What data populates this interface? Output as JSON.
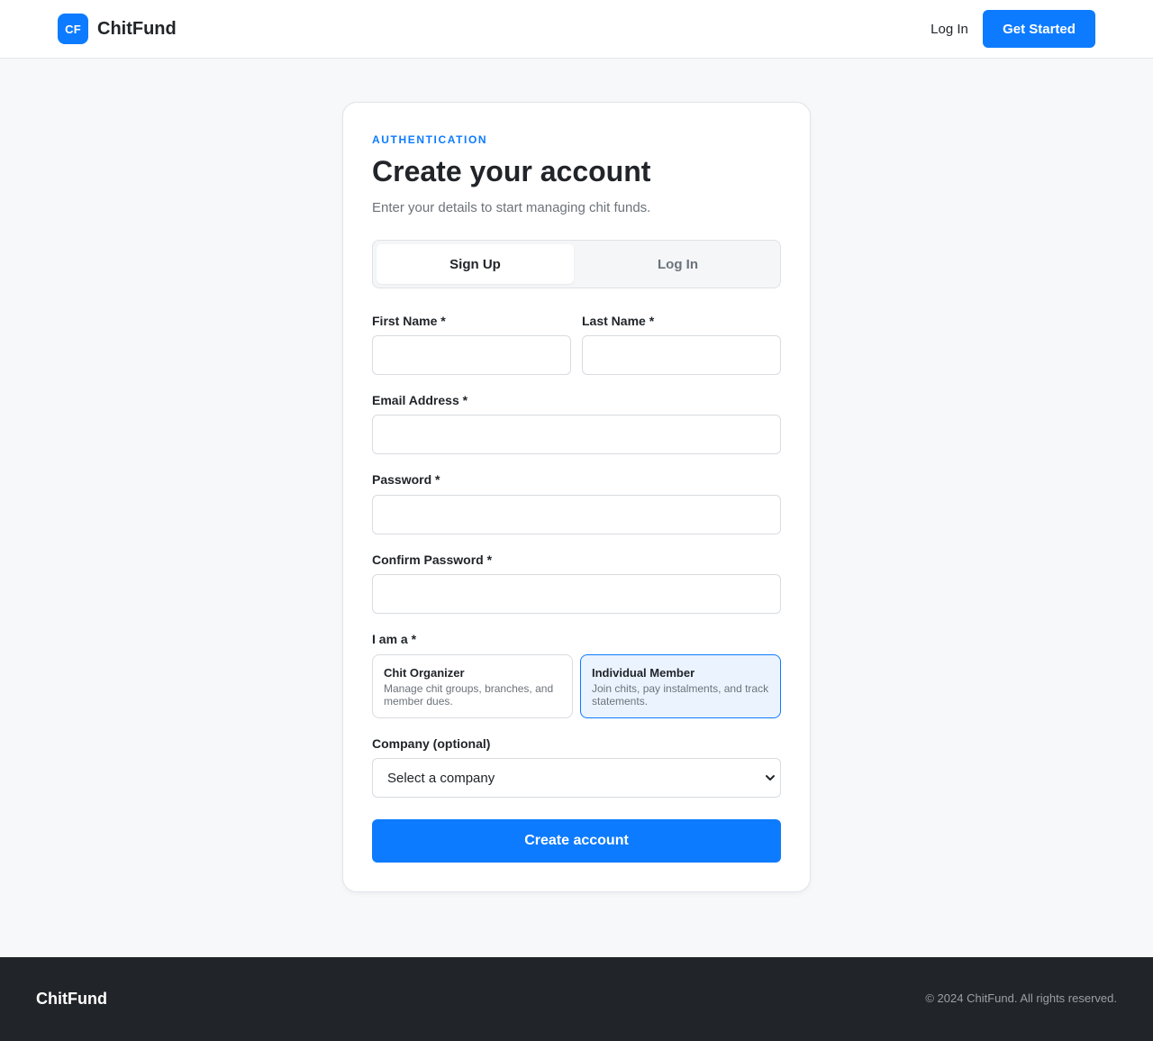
{
  "header": {
    "logo_initials": "CF",
    "brand": "ChitFund",
    "login_link": "Log In",
    "cta_button": "Get Started"
  },
  "card": {
    "eyebrow": "AUTHENTICATION",
    "title": "Create your account",
    "subtitle": "Enter your details to start managing chit funds.",
    "tabs": [
      {
        "label": "Sign Up",
        "active": true
      },
      {
        "label": "Log In",
        "active": false
      }
    ],
    "fields": {
      "first_name": {
        "label": "First Name *",
        "value": "",
        "placeholder": ""
      },
      "last_name": {
        "label": "Last Name *",
        "value": "",
        "placeholder": ""
      },
      "email": {
        "label": "Email Address *",
        "value": "",
        "placeholder": ""
      },
      "password": {
        "label": "Password *",
        "value": "",
        "placeholder": ""
      },
      "confirm_password": {
        "label": "Confirm Password *",
        "value": "",
        "placeholder": ""
      }
    },
    "role": {
      "label": "I am a *",
      "options": [
        {
          "title": "Chit Organizer",
          "description": "Manage chit groups, branches, and member dues.",
          "selected": false
        },
        {
          "title": "Individual Member",
          "description": "Join chits, pay instalments, and track statements.",
          "selected": true
        }
      ]
    },
    "company": {
      "label": "Company (optional)",
      "selected": "Select a company"
    },
    "submit": "Create account"
  },
  "footer": {
    "brand": "ChitFund",
    "copyright": "© 2024 ChitFund. All rights reserved."
  },
  "colors": {
    "accent": "#0d7bff",
    "selected_bg": "#ebf3ff",
    "footer_bg": "#212428",
    "page_bg": "#f7f8fa"
  }
}
